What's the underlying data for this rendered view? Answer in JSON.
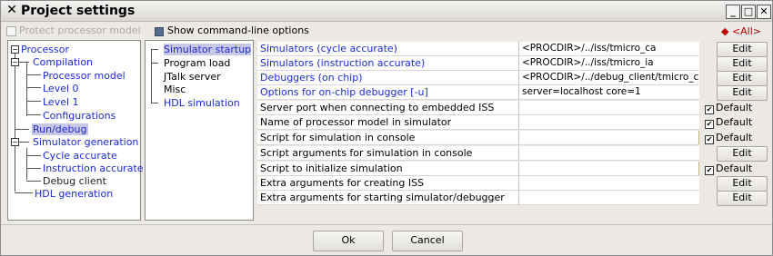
{
  "window": {
    "title": "Project settings",
    "all_label": "◆ <All>"
  },
  "options": {
    "protect_processor_model": "Protect processor model",
    "show_command_line_options": "Show command-line options"
  },
  "tree": [
    {
      "label": "Processor"
    },
    {
      "label": "Compilation"
    },
    {
      "label": "Processor model"
    },
    {
      "label": "Level 0"
    },
    {
      "label": "Level 1"
    },
    {
      "label": "Configurations"
    },
    {
      "label": "Run/debug"
    },
    {
      "label": "Simulator generation"
    },
    {
      "label": "Cycle accurate"
    },
    {
      "label": "Instruction accurate"
    },
    {
      "label": "Debug client"
    },
    {
      "label": "HDL generation"
    }
  ],
  "subsections": [
    {
      "label": "Simulator startup"
    },
    {
      "label": "Program load"
    },
    {
      "label": "JTalk server"
    },
    {
      "label": "Misc"
    },
    {
      "label": "HDL simulation"
    }
  ],
  "settings": [
    {
      "name": "Simulators (cycle accurate)",
      "value": "<PROCDIR>/../iss/tmicro_ca",
      "button": "Edit"
    },
    {
      "name": "Simulators (instruction accurate)",
      "value": "<PROCDIR>/../iss/tmicro_ia",
      "button": "Edit"
    },
    {
      "name": "Debuggers (on chip)",
      "value": "<PROCDIR>/../debug_client/tmicro_client",
      "button": "Edit"
    },
    {
      "name": "Options for on-chip debugger [-u]",
      "value": "server=localhost core=1",
      "button": "Edit"
    },
    {
      "name": "Server port when connecting to embedded ISS",
      "value": "",
      "button": "Default"
    },
    {
      "name": "Name of processor model in simulator",
      "value": "",
      "button": "Default"
    },
    {
      "name": "Script for simulation in console",
      "value": "",
      "button": "Default"
    },
    {
      "name": "Script arguments for simulation in console",
      "value": "",
      "button": "Edit"
    },
    {
      "name": "Script to initialize simulation",
      "value": "",
      "button": "Default"
    },
    {
      "name": "Extra arguments for creating ISS",
      "value": "",
      "button": "Edit"
    },
    {
      "name": "Extra arguments for starting simulator/debugger",
      "value": "",
      "button": "Edit"
    }
  ],
  "buttons": {
    "ok": "Ok",
    "cancel": "Cancel"
  },
  "icons": {
    "title": "x-logo-icon",
    "minimize": "minimize-icon",
    "maximize": "maximize-icon",
    "close": "close-icon",
    "folder": "folder-icon"
  }
}
